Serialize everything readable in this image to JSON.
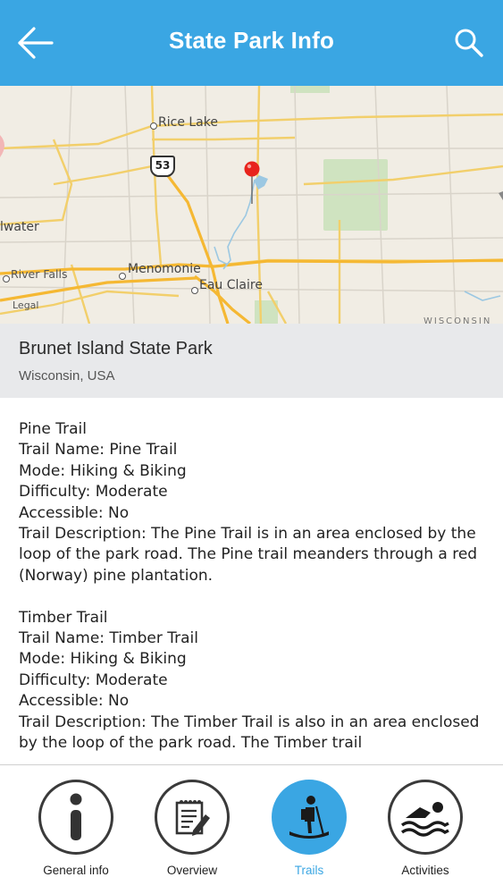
{
  "header": {
    "title": "State Park Info",
    "back_icon": "arrow-left-icon",
    "search_icon": "search-icon",
    "background_color": "#3aa6e3"
  },
  "map": {
    "labels": {
      "rice_lake": "Rice Lake",
      "highway": "53",
      "stillwater": "lwater",
      "river_falls": "River Falls",
      "menomonie": "Menomonie",
      "eau_claire": "Eau Claire",
      "legal": "Legal",
      "wisconsin": "WISCONSIN"
    },
    "pin_icon": "map-pin-icon",
    "pin_color": "#e8241c"
  },
  "park": {
    "name": "Brunet Island State Park",
    "location": "Wisconsin, USA"
  },
  "trails": [
    {
      "heading": "Pine Trail",
      "name_line": "Trail Name: Pine Trail",
      "mode_line": "Mode: Hiking & Biking",
      "difficulty_line": "Difficulty: Moderate",
      "accessible_line": "Accessible: No",
      "description_line": "Trail Description: The Pine Trail is in an area enclosed by the loop of the park road. The Pine trail meanders through a red (Norway) pine plantation."
    },
    {
      "heading": "Timber Trail",
      "name_line": "Trail Name: Timber Trail",
      "mode_line": "Mode: Hiking & Biking",
      "difficulty_line": "Difficulty: Moderate",
      "accessible_line": "Accessible: No",
      "description_line": "Trail Description: The Timber Trail is also in an area enclosed by the loop of the park road. The Timber trail"
    }
  ],
  "tabs": [
    {
      "label": "General info",
      "icon": "info-icon",
      "active": false
    },
    {
      "label": "Overview",
      "icon": "notepad-pencil-icon",
      "active": false
    },
    {
      "label": "Trails",
      "icon": "hiker-icon",
      "active": true
    },
    {
      "label": "Activities",
      "icon": "swimmer-icon",
      "active": false
    }
  ],
  "colors": {
    "accent": "#3aa6e3",
    "tab_border": "#3a3a3a",
    "info_band": "#e8e9eb"
  }
}
